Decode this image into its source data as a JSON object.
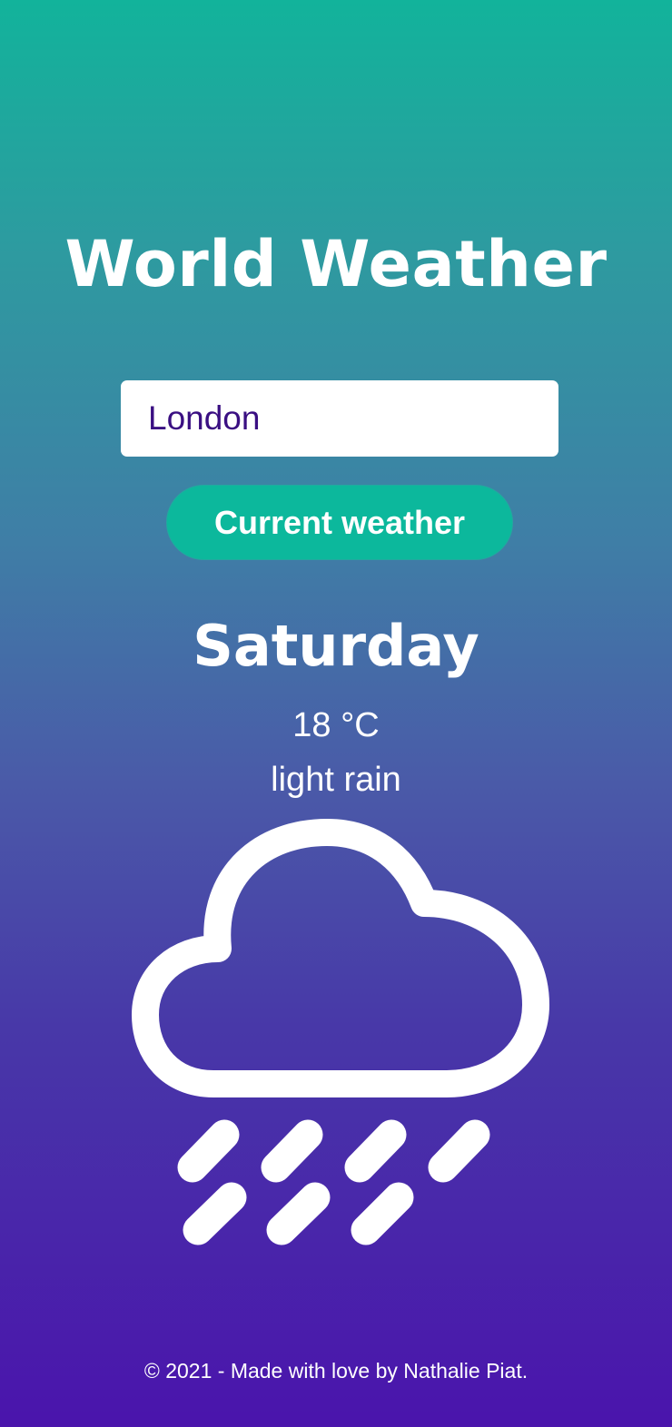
{
  "app": {
    "title": "World Weather"
  },
  "search": {
    "value": "London"
  },
  "button": {
    "label": "Current weather"
  },
  "weather": {
    "day": "Saturday",
    "temperature": "18 °C",
    "description": "light rain",
    "icon": "rain-cloud-icon"
  },
  "footer": {
    "text": "© 2021 - Made with love by Nathalie Piat."
  },
  "colors": {
    "gradient_top": "#12b39b",
    "gradient_bottom": "#4a14ac",
    "button_bg": "#0cb89c",
    "input_text": "#3a0f82",
    "text": "#ffffff"
  }
}
